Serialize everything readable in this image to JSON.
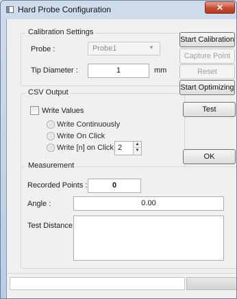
{
  "window": {
    "title": "Hard Probe Configuration",
    "close_glyph": "✕"
  },
  "calibration": {
    "group_label": "Calibration Settings",
    "probe_label": "Probe :",
    "probe_value": "Probe1",
    "tip_label": "Tip Diameter :",
    "tip_value": "1",
    "tip_unit": "mm"
  },
  "csv": {
    "group_label": "CSV Output",
    "write_values_label": "Write Values",
    "write_values_checked": false,
    "options": [
      "Write Continuously",
      "Write On Click",
      "Write [n] on Click"
    ],
    "n_value": "2"
  },
  "buttons": {
    "start_calibration": "Start Calibration",
    "capture_point": "Capture Point",
    "reset": "Reset",
    "start_optimizing": "Start Optimizing",
    "test": "Test",
    "ok": "OK"
  },
  "measurement": {
    "group_label": "Measurement",
    "recorded_label": "Recorded Points :",
    "recorded_value": "0",
    "angle_label": "Angle :",
    "angle_value": "0.00",
    "test_distance_label": "Test Distance :",
    "test_distance_value": ""
  },
  "icons": {
    "app": "window-app-icon",
    "close": "close-icon",
    "spin_up": "spin-up-icon",
    "spin_down": "spin-down-icon",
    "combo": "chevron-down-icon"
  }
}
